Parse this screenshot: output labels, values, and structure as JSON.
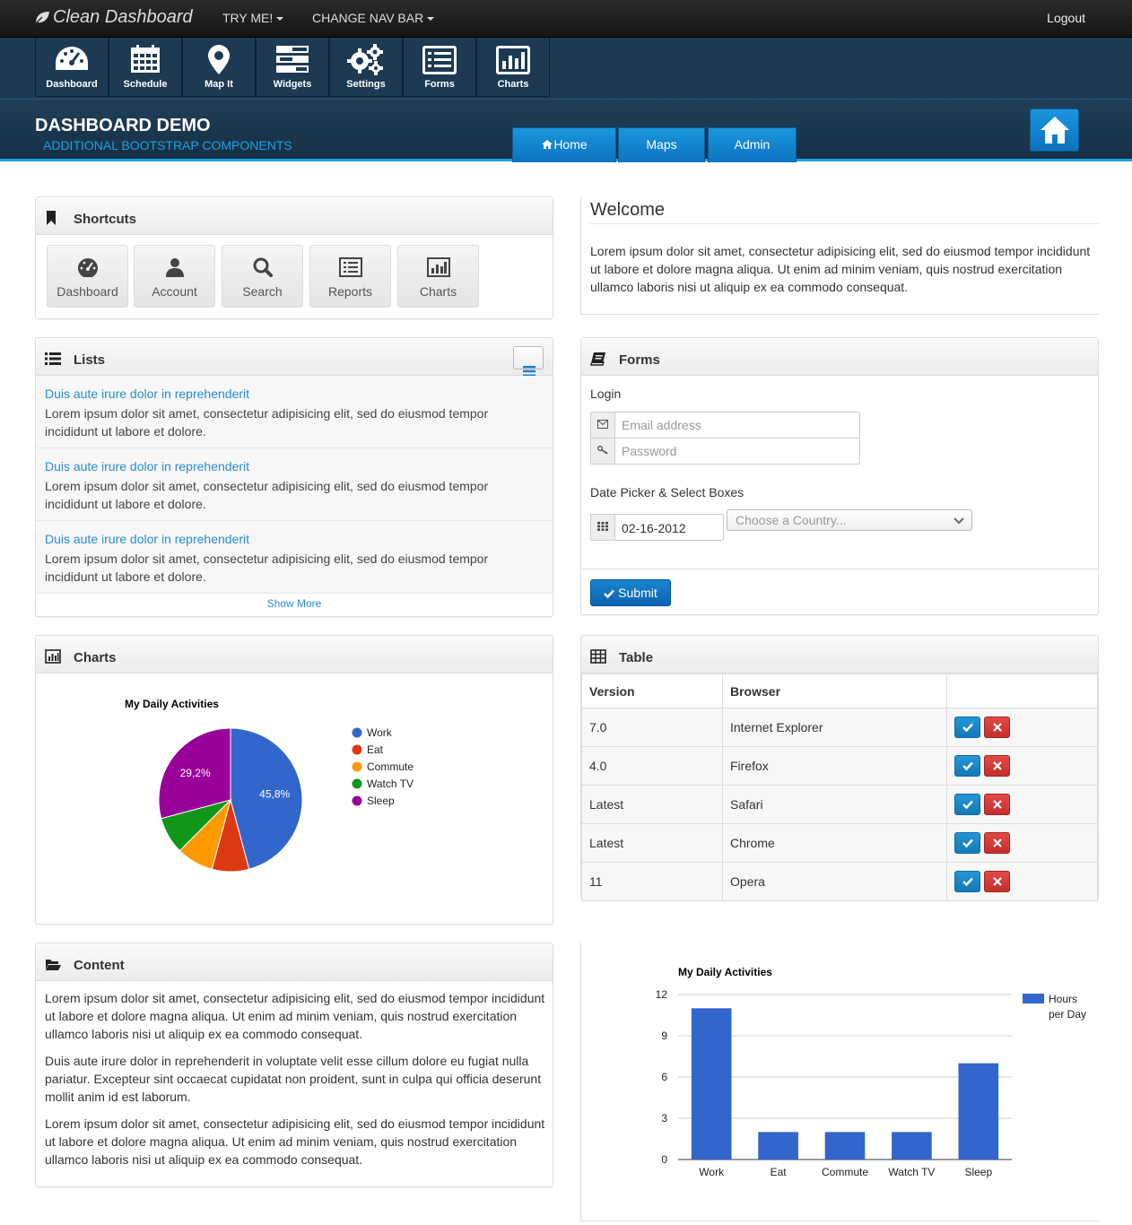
{
  "brand": "Clean Dashboard",
  "topnav": {
    "try_me": "TRY ME!",
    "change_nav": "CHANGE NAV BAR",
    "logout": "Logout"
  },
  "iconbar": [
    "Dashboard",
    "Schedule",
    "Map It",
    "Widgets",
    "Settings",
    "Forms",
    "Charts"
  ],
  "subheader": {
    "title": "DASHBOARD DEMO",
    "subtitle": "ADDITIONAL BOOTSTRAP COMPONENTS",
    "tabs": [
      "Home",
      "Maps",
      "Admin"
    ]
  },
  "shortcuts": {
    "title": "Shortcuts",
    "items": [
      "Dashboard",
      "Account",
      "Search",
      "Reports",
      "Charts"
    ]
  },
  "welcome": {
    "title": "Welcome",
    "text": "Lorem ipsum dolor sit amet, consectetur adipisicing elit, sed do eiusmod tempor incididunt ut labore et dolore magna aliqua. Ut enim ad minim veniam, quis nostrud exercitation ullamco laboris nisi ut aliquip ex ea commodo consequat."
  },
  "lists": {
    "title": "Lists",
    "items": [
      {
        "link": "Duis aute irure dolor in reprehenderit",
        "text": "Lorem ipsum dolor sit amet, consectetur adipisicing elit, sed do eiusmod tempor incididunt ut labore et dolore."
      },
      {
        "link": "Duis aute irure dolor in reprehenderit",
        "text": "Lorem ipsum dolor sit amet, consectetur adipisicing elit, sed do eiusmod tempor incididunt ut labore et dolore."
      },
      {
        "link": "Duis aute irure dolor in reprehenderit",
        "text": "Lorem ipsum dolor sit amet, consectetur adipisicing elit, sed do eiusmod tempor incididunt ut labore et dolore."
      }
    ],
    "show_more": "Show More"
  },
  "forms": {
    "title": "Forms",
    "login_label": "Login",
    "email_placeholder": "Email address",
    "password_placeholder": "Password",
    "date_label": "Date Picker & Select Boxes",
    "date_value": "02-16-2012",
    "country_placeholder": "Choose a Country...",
    "submit": "Submit"
  },
  "charts_panel": {
    "title": "Charts"
  },
  "table": {
    "title": "Table",
    "headers": [
      "Version",
      "Browser",
      ""
    ],
    "rows": [
      [
        "7.0",
        "Internet Explorer"
      ],
      [
        "4.0",
        "Firefox"
      ],
      [
        "Latest",
        "Safari"
      ],
      [
        "Latest",
        "Chrome"
      ],
      [
        "11",
        "Opera"
      ]
    ]
  },
  "content": {
    "title": "Content",
    "paragraphs": [
      "Lorem ipsum dolor sit amet, consectetur adipisicing elit, sed do eiusmod tempor incididunt ut labore et dolore magna aliqua. Ut enim ad minim veniam, quis nostrud exercitation ullamco laboris nisi ut aliquip ex ea commodo consequat.",
      "Duis aute irure dolor in reprehenderit in voluptate velit esse cillum dolore eu fugiat nulla pariatur. Excepteur sint occaecat cupidatat non proident, sunt in culpa qui officia deserunt mollit anim id est laborum.",
      "Lorem ipsum dolor sit amet, consectetur adipisicing elit, sed do eiusmod tempor incididunt ut labore et dolore magna aliqua. Ut enim ad minim veniam, quis nostrud exercitation ullamco laboris nisi ut aliquip ex ea commodo consequat."
    ]
  },
  "colors": {
    "accent": "#1aa1e0",
    "navbar": "#1d3a52",
    "link": "#2a8ccf",
    "chart_blue": "#3366cc"
  },
  "chart_data": [
    {
      "type": "pie",
      "title": "My Daily Activities",
      "categories": [
        "Work",
        "Eat",
        "Commute",
        "Watch TV",
        "Sleep"
      ],
      "values": [
        11,
        2,
        2,
        2,
        7
      ],
      "slice_labels": [
        "45,8%",
        "",
        "",
        "",
        "29,2%"
      ],
      "colors": [
        "#3366cc",
        "#dc3912",
        "#ff9900",
        "#109618",
        "#990099"
      ],
      "legend": "right"
    },
    {
      "type": "bar",
      "title": "My Daily Activities",
      "categories": [
        "Work",
        "Eat",
        "Commute",
        "Watch TV",
        "Sleep"
      ],
      "series": [
        {
          "name": "Hours per Day",
          "values": [
            11,
            2,
            2,
            2,
            7
          ]
        }
      ],
      "ylim": [
        0,
        12
      ],
      "yticks": [
        0,
        3,
        6,
        9,
        12
      ],
      "grid": true,
      "legend": "right"
    }
  ]
}
